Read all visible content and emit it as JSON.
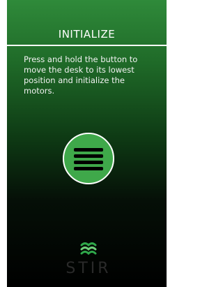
{
  "screen": {
    "title": "INITIALIZE",
    "instructions": "Press and hold the button to move the desk to its lowest position and initialize the motors."
  },
  "button": {
    "icon": "hamburger-lines-icon",
    "label": ""
  },
  "branding": {
    "logo_icon": "stir-wave-logo-icon",
    "logo_text": "STIR"
  },
  "colors": {
    "accent_green": "#3fa84a",
    "panel_top": "#2f8a3a",
    "panel_bottom": "#000000"
  }
}
